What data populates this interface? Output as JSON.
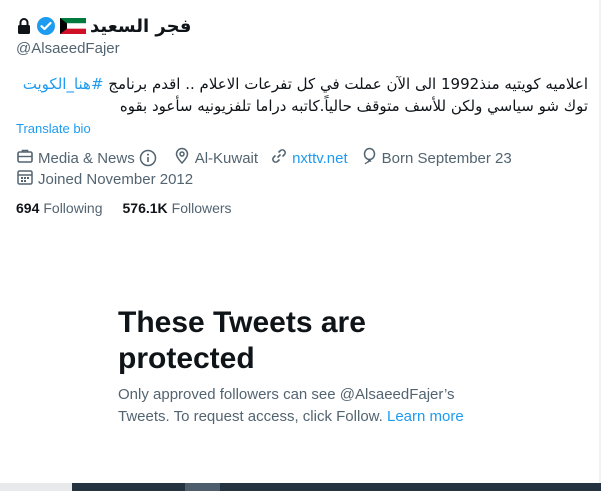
{
  "profile": {
    "display_name": "فجر السعيد",
    "handle": "@AlsaeedFajer",
    "flag": "kuwait-flag",
    "bio_line1_prefix": "اعلاميه كويتيه منذ1992 الى الآن عملت في كل تفرعات الاعلام .. اقدم برنامج ",
    "bio_hashtag": "#هنا_الكويت",
    "bio_line2": "توك شو سياسي ولكن للأسف متوقف حالياً.كاتبه دراما تلفزيونيه سأعود بقوه",
    "translate_label": "Translate bio"
  },
  "meta": {
    "category": "Media & News",
    "location": "Al-Kuwait",
    "website": "nxttv.net",
    "born": "Born September 23",
    "joined": "Joined November 2012"
  },
  "stats": {
    "following_count": "694",
    "following_label": "Following",
    "followers_count": "576.1K",
    "followers_label": "Followers"
  },
  "protected": {
    "title": "These Tweets are protected",
    "body": "Only approved followers can see @AlsaeedFajer’s Tweets. To request access, click Follow. ",
    "learn_more": "Learn more"
  },
  "colors": {
    "accent": "#1d9bf0",
    "muted": "#536471",
    "text": "#0f1419"
  },
  "icons": [
    "lock-icon",
    "verified-badge-icon",
    "kuwait-flag",
    "briefcase-icon",
    "info-icon",
    "location-icon",
    "link-icon",
    "balloon-icon",
    "calendar-icon"
  ]
}
